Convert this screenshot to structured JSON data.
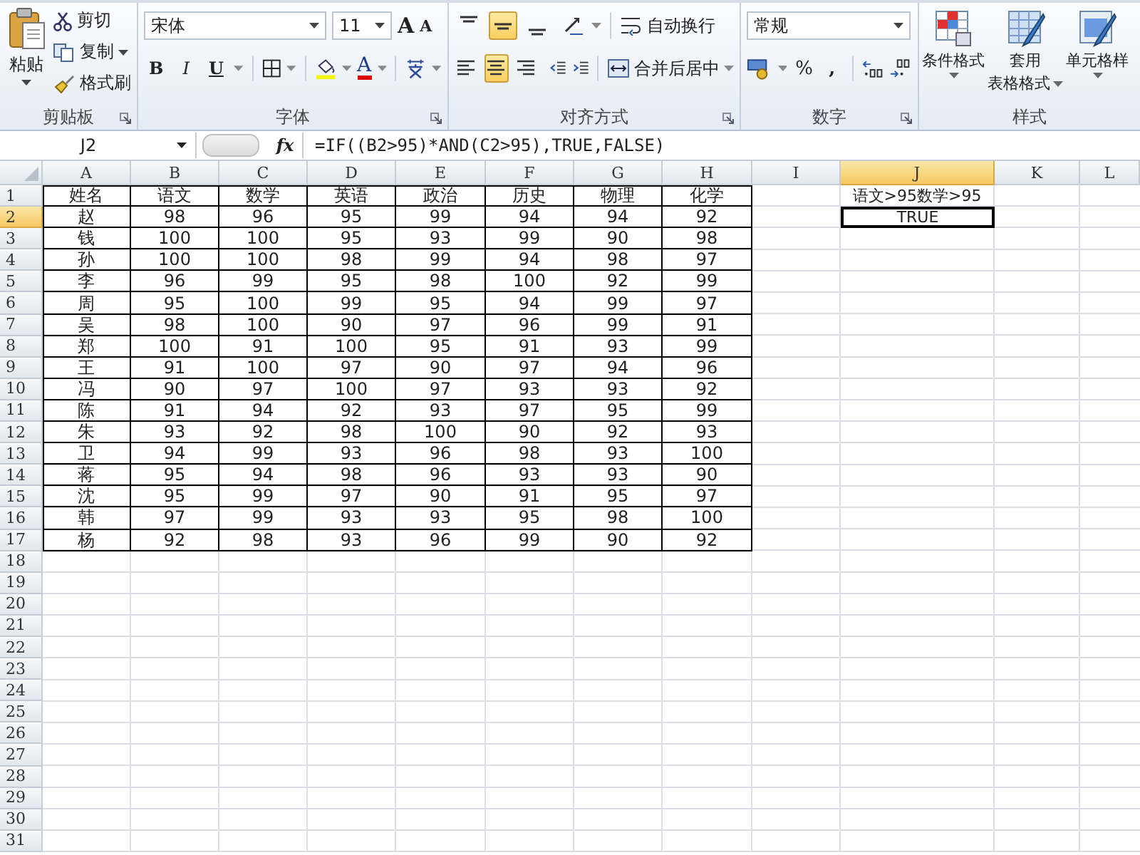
{
  "ribbon": {
    "clipboard": {
      "label": "剪贴板",
      "paste": "粘贴",
      "cut": "剪切",
      "copy": "复制",
      "format_painter": "格式刷"
    },
    "font": {
      "label": "字体",
      "font_name": "宋体",
      "font_size": "11",
      "grow": "A",
      "shrink": "A",
      "styles": [
        "B",
        "I",
        "U"
      ],
      "font_color": "A"
    },
    "alignment": {
      "label": "对齐方式",
      "vertical": [
        {
          "selected": false
        },
        {
          "selected": true
        },
        {
          "selected": false
        }
      ],
      "horizontal": [
        {
          "selected": false
        },
        {
          "selected": true
        },
        {
          "selected": false
        }
      ],
      "wrap_text": "自动换行",
      "merge_center": "合并后居中"
    },
    "number": {
      "label": "数字",
      "format": "常规",
      "percent": "%",
      "comma": ","
    },
    "styles": {
      "label": "样式",
      "buttons": [
        {
          "kind": "conditional",
          "lines": [
            "条件格式"
          ]
        },
        {
          "kind": "table",
          "lines": [
            "套用",
            "表格格式"
          ]
        },
        {
          "kind": "cell",
          "lines": [
            "单元格样"
          ]
        }
      ]
    }
  },
  "formula_bar": {
    "name_box": "J2",
    "function_label": "fx",
    "formula": "=IF((B2>95)*AND(C2>95),TRUE,FALSE)"
  },
  "sheet": {
    "columns": [
      {
        "letter": "A",
        "selected": false
      },
      {
        "letter": "B",
        "selected": false
      },
      {
        "letter": "C",
        "selected": false
      },
      {
        "letter": "D",
        "selected": false
      },
      {
        "letter": "E",
        "selected": false
      },
      {
        "letter": "F",
        "selected": false
      },
      {
        "letter": "G",
        "selected": false
      },
      {
        "letter": "H",
        "selected": false
      },
      {
        "letter": "I",
        "selected": false
      },
      {
        "letter": "J",
        "selected": true
      },
      {
        "letter": "K",
        "selected": false
      },
      {
        "letter": "L",
        "selected": false
      }
    ],
    "rows": [
      {
        "label": "1",
        "selected": false
      },
      {
        "label": "2",
        "selected": true
      },
      {
        "label": "3",
        "selected": false
      },
      {
        "label": "4",
        "selected": false
      },
      {
        "label": "5",
        "selected": false
      },
      {
        "label": "6",
        "selected": false
      },
      {
        "label": "7",
        "selected": false
      },
      {
        "label": "8",
        "selected": false
      },
      {
        "label": "9",
        "selected": false
      },
      {
        "label": "10",
        "selected": false
      },
      {
        "label": "11",
        "selected": false
      },
      {
        "label": "12",
        "selected": false
      },
      {
        "label": "13",
        "selected": false
      },
      {
        "label": "14",
        "selected": false
      },
      {
        "label": "15",
        "selected": false
      },
      {
        "label": "16",
        "selected": false
      },
      {
        "label": "17",
        "selected": false
      },
      {
        "label": "18",
        "selected": false
      },
      {
        "label": "19",
        "selected": false
      },
      {
        "label": "20",
        "selected": false
      },
      {
        "label": "21",
        "selected": false
      },
      {
        "label": "22",
        "selected": false
      },
      {
        "label": "23",
        "selected": false
      },
      {
        "label": "24",
        "selected": false
      },
      {
        "label": "25",
        "selected": false
      },
      {
        "label": "26",
        "selected": false
      },
      {
        "label": "27",
        "selected": false
      },
      {
        "label": "28",
        "selected": false
      },
      {
        "label": "29",
        "selected": false
      },
      {
        "label": "30",
        "selected": false
      },
      {
        "label": "31",
        "selected": false
      }
    ],
    "table": {
      "header": [
        "姓名",
        "语文",
        "数学",
        "英语",
        "政治",
        "历史",
        "物理",
        "化学"
      ],
      "rows": [
        [
          "赵",
          "98",
          "96",
          "95",
          "99",
          "94",
          "94",
          "92"
        ],
        [
          "钱",
          "100",
          "100",
          "95",
          "93",
          "99",
          "90",
          "98"
        ],
        [
          "孙",
          "100",
          "100",
          "98",
          "99",
          "94",
          "98",
          "97"
        ],
        [
          "李",
          "96",
          "99",
          "95",
          "98",
          "100",
          "92",
          "99"
        ],
        [
          "周",
          "95",
          "100",
          "99",
          "95",
          "94",
          "99",
          "97"
        ],
        [
          "吴",
          "98",
          "100",
          "90",
          "97",
          "96",
          "99",
          "91"
        ],
        [
          "郑",
          "100",
          "91",
          "100",
          "95",
          "91",
          "93",
          "99"
        ],
        [
          "王",
          "91",
          "100",
          "97",
          "90",
          "97",
          "94",
          "96"
        ],
        [
          "冯",
          "90",
          "97",
          "100",
          "97",
          "93",
          "93",
          "92"
        ],
        [
          "陈",
          "91",
          "94",
          "92",
          "93",
          "97",
          "95",
          "99"
        ],
        [
          "朱",
          "93",
          "92",
          "98",
          "100",
          "90",
          "92",
          "93"
        ],
        [
          "卫",
          "94",
          "99",
          "93",
          "96",
          "98",
          "93",
          "100"
        ],
        [
          "蒋",
          "95",
          "94",
          "98",
          "96",
          "93",
          "93",
          "90"
        ],
        [
          "沈",
          "95",
          "99",
          "97",
          "90",
          "91",
          "95",
          "97"
        ],
        [
          "韩",
          "97",
          "99",
          "93",
          "93",
          "95",
          "98",
          "100"
        ],
        [
          "杨",
          "92",
          "98",
          "93",
          "96",
          "99",
          "90",
          "92"
        ]
      ]
    },
    "side_cells": [
      {
        "text": "语文>95数学>95",
        "selected": false
      },
      {
        "text": "TRUE",
        "selected": true
      }
    ]
  }
}
